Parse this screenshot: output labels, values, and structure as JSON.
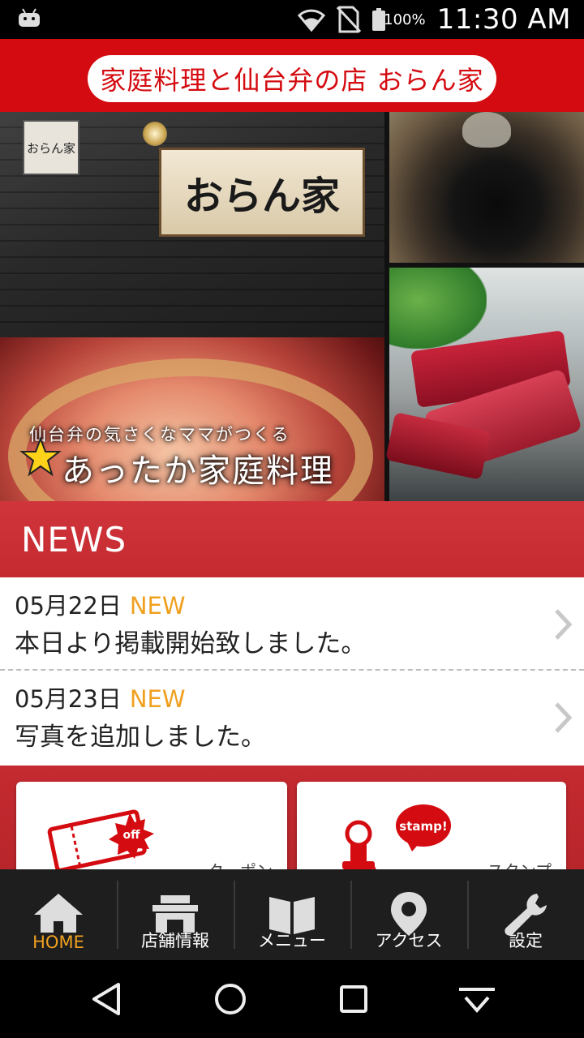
{
  "status_bar": {
    "battery_percent": "100%",
    "time": "11:30 AM"
  },
  "header": {
    "title": "家庭料理と仙台弁の店 おらん家"
  },
  "hero": {
    "sign_text": "おらん家",
    "small_sign_text": "おらん家",
    "caption_top": "仙台弁の気さくなママがつくる",
    "caption_main": "あったか家庭料理"
  },
  "news": {
    "heading": "NEWS",
    "items": [
      {
        "date": "05月22日",
        "badge": "NEW",
        "text": "本日より掲載開始致しました。"
      },
      {
        "date": "05月23日",
        "badge": "NEW",
        "text": "写真を追加しました。"
      }
    ]
  },
  "cards": {
    "coupon": {
      "label": "クーポン",
      "badge_text": "off"
    },
    "stamp": {
      "label": "スタンプ",
      "badge_text": "stamp!"
    }
  },
  "tabs": [
    {
      "label": "HOME",
      "icon": "home-icon",
      "active": true
    },
    {
      "label": "店舗情報",
      "icon": "store-icon",
      "active": false
    },
    {
      "label": "メニュー",
      "icon": "book-icon",
      "active": false
    },
    {
      "label": "アクセス",
      "icon": "map-pin-icon",
      "active": false
    },
    {
      "label": "設定",
      "icon": "wrench-icon",
      "active": false
    }
  ],
  "colors": {
    "brand_red": "#d40b10",
    "news_red": "#c42a30",
    "new_badge": "#f0a020",
    "tab_active": "#f0a020",
    "tabbar_bg": "#1e1e1e"
  }
}
